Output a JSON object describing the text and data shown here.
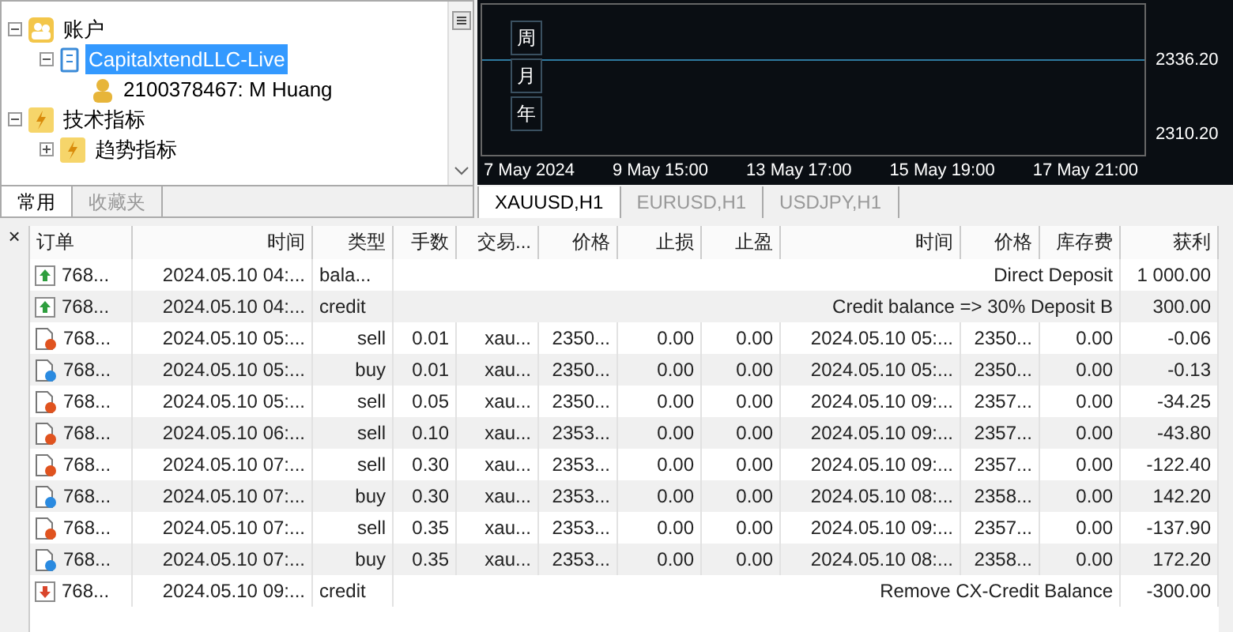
{
  "navigator": {
    "tree": [
      {
        "label": "账户",
        "kind": "accounts",
        "expanded": true,
        "selected": false,
        "children": [
          {
            "label": "CapitalxtendLLC-Live",
            "kind": "server",
            "expanded": true,
            "selected": true,
            "children": [
              {
                "label": "2100378467: M Huang",
                "kind": "user",
                "selected": false
              }
            ]
          }
        ]
      },
      {
        "label": "技术指标",
        "kind": "indicators",
        "expanded": true,
        "selected": false,
        "children": [
          {
            "label": "趋势指标",
            "kind": "indicators",
            "expanded": false,
            "selected": false
          }
        ]
      }
    ],
    "tabs": [
      {
        "label": "常用",
        "selected": true
      },
      {
        "label": "收藏夹",
        "selected": false
      }
    ]
  },
  "chart": {
    "period_buttons": [
      "周",
      "月",
      "年"
    ],
    "price_labels": [
      "2336.20",
      "2310.20"
    ],
    "time_labels": [
      "7 May 2024",
      "9 May 15:00",
      "13 May 17:00",
      "15 May 19:00",
      "17 May 21:00"
    ],
    "tabs": [
      {
        "label": "XAUUSD,H1",
        "selected": true
      },
      {
        "label": "EURUSD,H1",
        "selected": false
      },
      {
        "label": "USDJPY,H1",
        "selected": false
      }
    ]
  },
  "table": {
    "close": "×",
    "columns": [
      "订单",
      "时间",
      "类型",
      "手数",
      "交易...",
      "价格",
      "止损",
      "止盈",
      "时间",
      "价格",
      "库存费",
      "获利"
    ],
    "rows": [
      {
        "kind": "balance_in",
        "order": "768...",
        "time": "2024.05.10 04:...",
        "type": "bala...",
        "comment": "Direct Deposit",
        "profit": "1 000.00"
      },
      {
        "kind": "balance_in",
        "order": "768...",
        "time": "2024.05.10 04:...",
        "type": "credit",
        "comment": "Credit balance => 30% Deposit B",
        "profit": "300.00"
      },
      {
        "kind": "sell",
        "order": "768...",
        "time": "2024.05.10 05:...",
        "type": "sell",
        "lots": "0.01",
        "symbol": "xau...",
        "price": "2350...",
        "sl": "0.00",
        "tp": "0.00",
        "close_time": "2024.05.10 05:...",
        "close_price": "2350...",
        "swap": "0.00",
        "profit": "-0.06"
      },
      {
        "kind": "buy",
        "order": "768...",
        "time": "2024.05.10 05:...",
        "type": "buy",
        "lots": "0.01",
        "symbol": "xau...",
        "price": "2350...",
        "sl": "0.00",
        "tp": "0.00",
        "close_time": "2024.05.10 05:...",
        "close_price": "2350...",
        "swap": "0.00",
        "profit": "-0.13"
      },
      {
        "kind": "sell",
        "order": "768...",
        "time": "2024.05.10 05:...",
        "type": "sell",
        "lots": "0.05",
        "symbol": "xau...",
        "price": "2350...",
        "sl": "0.00",
        "tp": "0.00",
        "close_time": "2024.05.10 09:...",
        "close_price": "2357...",
        "swap": "0.00",
        "profit": "-34.25"
      },
      {
        "kind": "sell",
        "order": "768...",
        "time": "2024.05.10 06:...",
        "type": "sell",
        "lots": "0.10",
        "symbol": "xau...",
        "price": "2353...",
        "sl": "0.00",
        "tp": "0.00",
        "close_time": "2024.05.10 09:...",
        "close_price": "2357...",
        "swap": "0.00",
        "profit": "-43.80"
      },
      {
        "kind": "sell",
        "order": "768...",
        "time": "2024.05.10 07:...",
        "type": "sell",
        "lots": "0.30",
        "symbol": "xau...",
        "price": "2353...",
        "sl": "0.00",
        "tp": "0.00",
        "close_time": "2024.05.10 09:...",
        "close_price": "2357...",
        "swap": "0.00",
        "profit": "-122.40"
      },
      {
        "kind": "buy",
        "order": "768...",
        "time": "2024.05.10 07:...",
        "type": "buy",
        "lots": "0.30",
        "symbol": "xau...",
        "price": "2353...",
        "sl": "0.00",
        "tp": "0.00",
        "close_time": "2024.05.10 08:...",
        "close_price": "2358...",
        "swap": "0.00",
        "profit": "142.20"
      },
      {
        "kind": "sell",
        "order": "768...",
        "time": "2024.05.10 07:...",
        "type": "sell",
        "lots": "0.35",
        "symbol": "xau...",
        "price": "2353...",
        "sl": "0.00",
        "tp": "0.00",
        "close_time": "2024.05.10 09:...",
        "close_price": "2357...",
        "swap": "0.00",
        "profit": "-137.90"
      },
      {
        "kind": "buy",
        "order": "768...",
        "time": "2024.05.10 07:...",
        "type": "buy",
        "lots": "0.35",
        "symbol": "xau...",
        "price": "2353...",
        "sl": "0.00",
        "tp": "0.00",
        "close_time": "2024.05.10 08:...",
        "close_price": "2358...",
        "swap": "0.00",
        "profit": "172.20"
      },
      {
        "kind": "balance_out",
        "order": "768...",
        "time": "2024.05.10 09:...",
        "type": "credit",
        "comment": "Remove CX-Credit Balance",
        "profit": "-300.00"
      }
    ]
  }
}
